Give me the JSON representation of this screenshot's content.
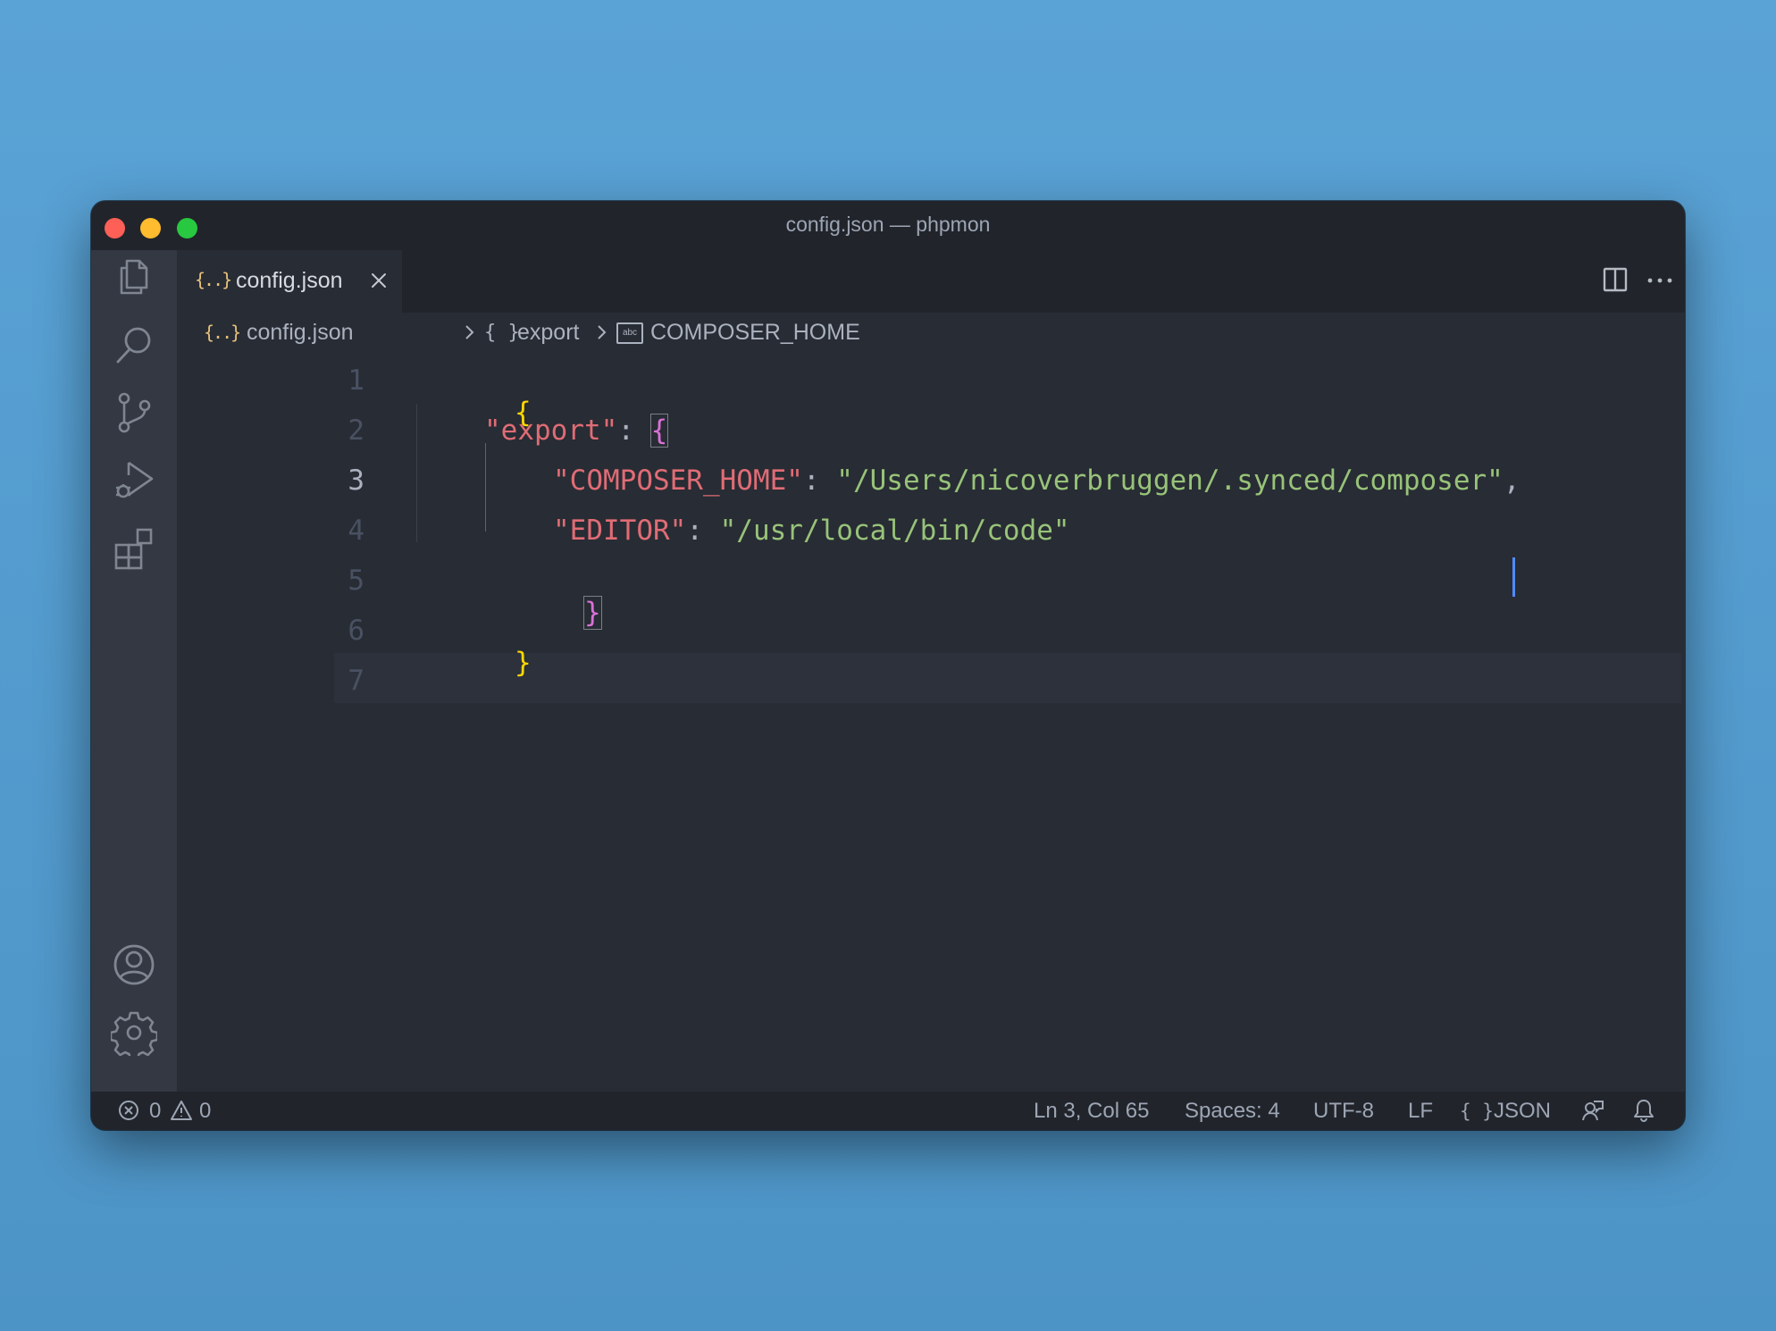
{
  "window": {
    "title": "config.json — phpmon"
  },
  "tab": {
    "icon_glyph": "{..}",
    "label": "config.json"
  },
  "breadcrumbs": {
    "file": "config.json",
    "object": "export",
    "object_glyph": "{ }",
    "property": "COMPOSER_HOME",
    "property_glyph": "abc"
  },
  "editor": {
    "lines": [
      {
        "number": "1"
      },
      {
        "number": "2"
      },
      {
        "number": "3"
      },
      {
        "number": "4"
      },
      {
        "number": "5"
      },
      {
        "number": "6"
      },
      {
        "number": "7"
      }
    ],
    "tokens": {
      "l1_brace": "{",
      "l2_key": "\"export\"",
      "l2_colon": ": ",
      "l2_brace": "{",
      "l3_key": "\"COMPOSER_HOME\"",
      "l3_colon": ": ",
      "l3_value": "\"/Users/nicoverbruggen/.synced/composer\"",
      "l3_comma": ",",
      "l4_key": "\"EDITOR\"",
      "l4_colon": ": ",
      "l4_value": "\"/usr/local/bin/code\"",
      "l5_brace": "}",
      "l6_brace": "}"
    },
    "active_line": "3"
  },
  "statusbar": {
    "errors": "0",
    "warnings": "0",
    "position": "Ln 3, Col 65",
    "spaces": "Spaces: 4",
    "encoding": "UTF-8",
    "eol": "LF",
    "language_glyph": "{ }",
    "language": "JSON"
  },
  "icons": {
    "activity": [
      "explorer-icon",
      "search-icon",
      "source-control-icon",
      "run-debug-icon",
      "extensions-icon",
      "account-icon",
      "settings-gear-icon"
    ],
    "editor_actions": [
      "split-editor-icon",
      "more-actions-icon"
    ],
    "status": [
      "error-icon",
      "warning-icon",
      "feedback-icon",
      "bell-icon"
    ]
  },
  "colors": {
    "key": "#e06c75",
    "string": "#98c379",
    "bracket_level1": "#ffd700",
    "bracket_level2": "#da70d6",
    "cursor": "#528bff",
    "json_icon": "#e5c07b"
  }
}
